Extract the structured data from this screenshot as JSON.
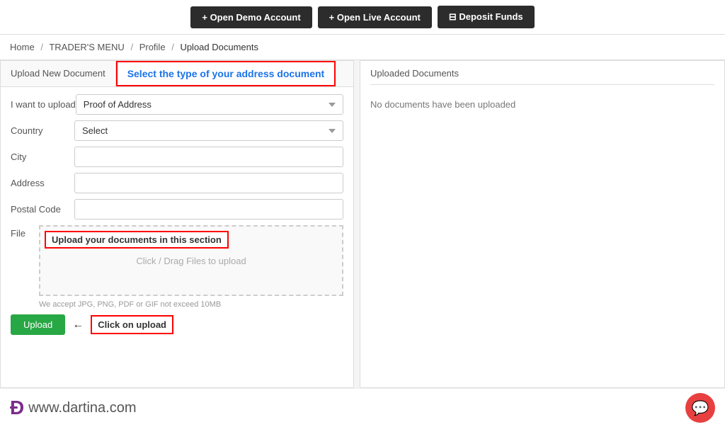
{
  "topNav": {
    "buttons": [
      {
        "id": "open-demo",
        "label": "+ Open Demo Account",
        "class": "btn-demo"
      },
      {
        "id": "open-live",
        "label": "+ Open Live Account",
        "class": "btn-live"
      },
      {
        "id": "deposit",
        "label": "⊟ Deposit Funds",
        "class": "btn-deposit"
      }
    ]
  },
  "breadcrumb": {
    "items": [
      "Home",
      "TRADER'S MENU",
      "Profile",
      "Upload Documents"
    ],
    "separator": "/"
  },
  "leftPanel": {
    "tabUploadNew": "Upload New Document",
    "tabSelectType": "Select the type of your address document",
    "tabUploaded": "Uploaded Documents",
    "form": {
      "iWantToUpload": "I want to upload",
      "documentType": "Proof of Address",
      "countryLabel": "Country",
      "countryPlaceholder": "Select",
      "cityLabel": "City",
      "addressLabel": "Address",
      "postalLabel": "Postal Code",
      "fileLabel": "File",
      "uploadAnnotation": "Upload your documents in this section",
      "uploadHint": "Click / Drag Files to upload",
      "acceptText": "We accept JPG, PNG, PDF or GIF not exceed 10MB"
    },
    "uploadBtn": "Upload",
    "clickOnUpload": "Click on upload"
  },
  "rightPanel": {
    "title": "Uploaded Documents",
    "noDocsText": "No documents have been uploaded"
  },
  "footer": {
    "dartinaDomain": "www.dartina.com",
    "dartinaLogoSymbol": "Ð"
  },
  "icons": {
    "chatIcon": "💬",
    "arrowRight": "←"
  }
}
